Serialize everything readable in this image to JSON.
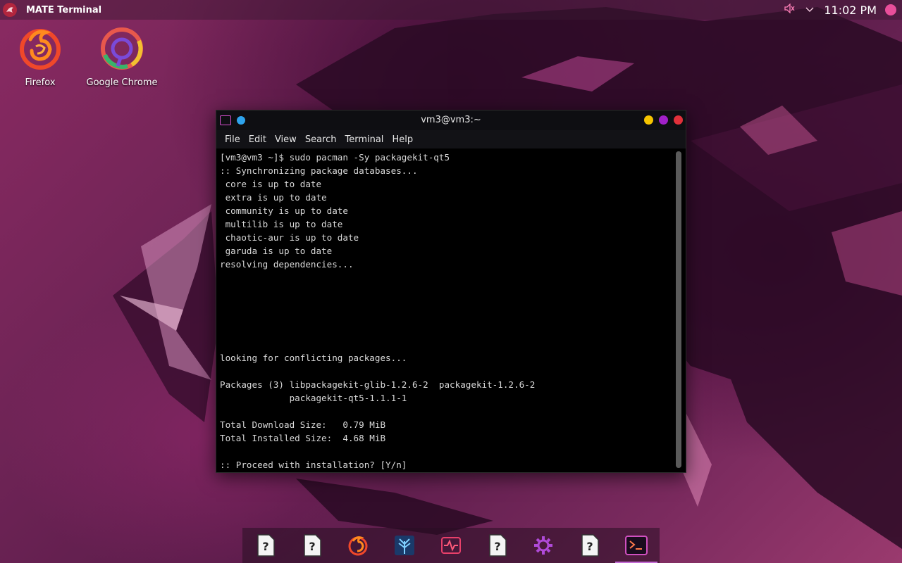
{
  "top_panel": {
    "active_window_title": "MATE Terminal",
    "clock": "11:02 PM",
    "icons": [
      "garuda-menu-icon",
      "volume-icon",
      "chevron-down-icon",
      "user-avatar-icon"
    ]
  },
  "desktop": {
    "icons": [
      {
        "label": "Firefox",
        "icon": "firefox-icon"
      },
      {
        "label": "Google Chrome",
        "icon": "chrome-icon"
      }
    ]
  },
  "terminal": {
    "title": "vm3@vm3:~",
    "menu": [
      "File",
      "Edit",
      "View",
      "Search",
      "Terminal",
      "Help"
    ],
    "lines": [
      "[vm3@vm3 ~]$ sudo pacman -Sy packagekit-qt5",
      ":: Synchronizing package databases...",
      " core is up to date",
      " extra is up to date",
      " community is up to date",
      " multilib is up to date",
      " chaotic-aur is up to date",
      " garuda is up to date",
      "resolving dependencies...",
      "",
      "",
      "",
      "",
      "",
      "",
      "looking for conflicting packages...",
      "",
      "Packages (3) libpackagekit-glib-1.2.6-2  packagekit-1.2.6-2",
      "             packagekit-qt5-1.1.1-1",
      "",
      "Total Download Size:   0.79 MiB",
      "Total Installed Size:  4.68 MiB",
      "",
      ":: Proceed with installation? [Y/n]"
    ],
    "window_button_colors": {
      "minimize": "#f5c400",
      "maximize": "#a020c8",
      "close": "#e0303a"
    }
  },
  "dock": {
    "items": [
      {
        "icon": "unknown-file-icon"
      },
      {
        "icon": "unknown-file-icon"
      },
      {
        "icon": "firefox-icon"
      },
      {
        "icon": "tree-app-icon"
      },
      {
        "icon": "system-monitor-icon"
      },
      {
        "icon": "unknown-file-icon"
      },
      {
        "icon": "settings-gear-icon"
      },
      {
        "icon": "unknown-file-icon"
      },
      {
        "icon": "terminal-icon",
        "active": true
      }
    ]
  },
  "colors": {
    "accent": "#c46bd6",
    "terminal_bg": "#000000",
    "terminal_fg": "#d9d9d9"
  }
}
